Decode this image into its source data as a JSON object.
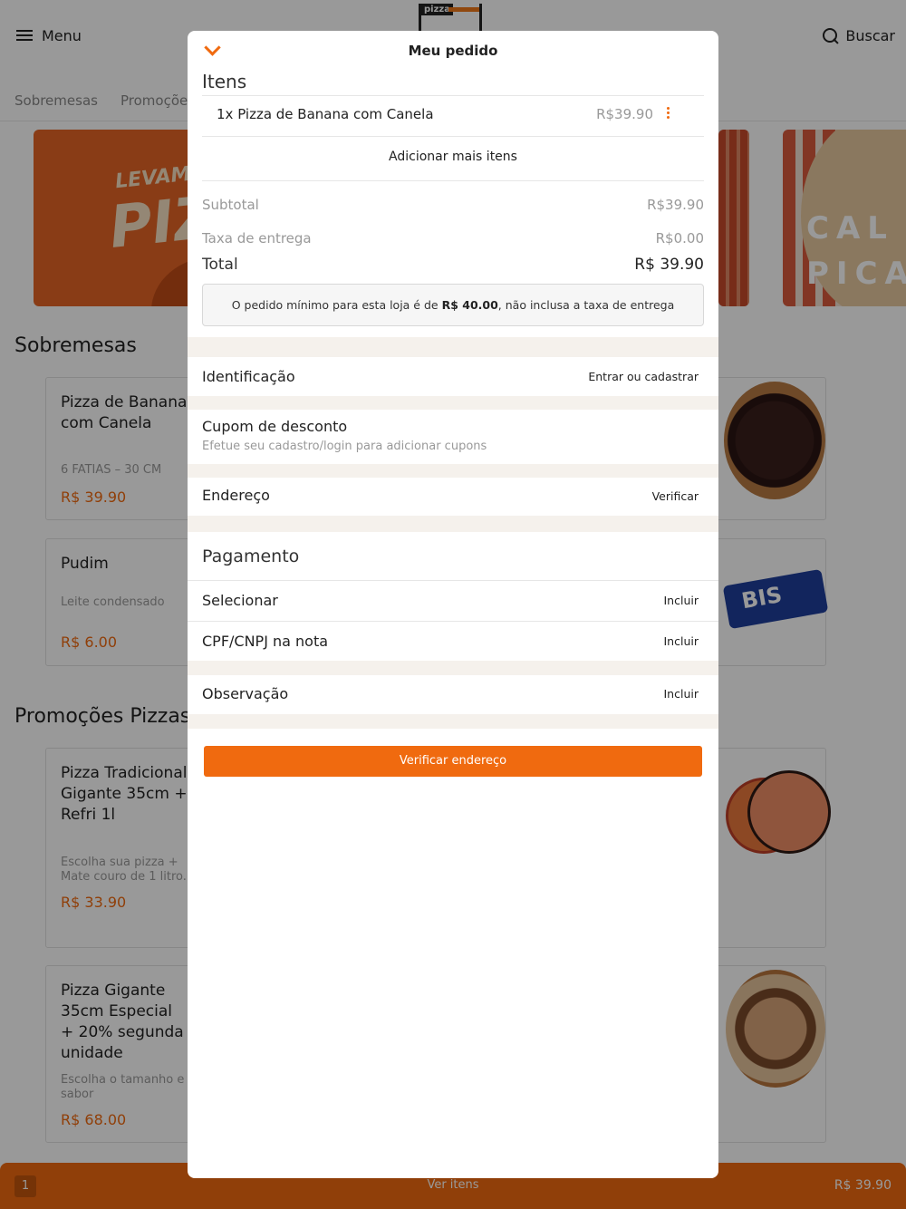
{
  "header": {
    "menu_label": "Menu",
    "search_label": "Buscar",
    "logo_text": "pizza"
  },
  "categories": [
    "Sobremesas",
    "Promoções"
  ],
  "sections": {
    "sobremesas_title": "Sobremesas",
    "promocoes_title": "Promoções Pizzas"
  },
  "products": [
    {
      "name": "Pizza de Banana com Canela",
      "desc": "6 FATIAS – 30 CM",
      "price": "R$ 39.90"
    },
    {
      "name": "Pudim",
      "desc": "Leite condensado",
      "price": "R$ 6.00"
    },
    {
      "name": "Pizza Tradicional Gigante 35cm + Refri 1l",
      "desc": "Escolha sua pizza + Mate couro de 1 litro.",
      "price": "R$ 33.90"
    },
    {
      "name": "Pizza Gigante 35cm Especial + 20% segunda unidade",
      "desc": "Escolha o tamanho e sabor",
      "price": "R$ 68.00"
    }
  ],
  "banners": {
    "b1_line1": "LEVAMO",
    "b1_line2": "PIZ",
    "b3_text": "CAL PICA"
  },
  "bottom_bar": {
    "count": "1",
    "label": "Ver itens",
    "total": "R$ 39.90"
  },
  "order": {
    "title": "Meu pedido",
    "items_heading": "Itens",
    "items": [
      {
        "label": "1x Pizza de Banana com Canela",
        "price": "R$39.90"
      }
    ],
    "add_more": "Adicionar mais itens",
    "subtotal_label": "Subtotal",
    "subtotal_value": "R$39.90",
    "delivery_label": "Taxa de entrega",
    "delivery_value": "R$0.00",
    "total_label": "Total",
    "total_value": "R$ 39.90",
    "min_note_pre": "O pedido mínimo para esta loja é de ",
    "min_note_amount": "R$ 40.00",
    "min_note_post": ", não inclusa a taxa de entrega",
    "identification_label": "Identificação",
    "identification_action": "Entrar ou cadastrar",
    "coupon_label": "Cupom de desconto",
    "coupon_sub": "Efetue seu cadastro/login para adicionar cupons",
    "address_label": "Endereço",
    "address_action": "Verificar",
    "payment_heading": "Pagamento",
    "select_label": "Selecionar",
    "select_action": "Incluir",
    "cpf_label": "CPF/CNPJ na nota",
    "cpf_action": "Incluir",
    "note_label": "Observação",
    "note_action": "Incluir",
    "cta_label": "Verificar endereço"
  },
  "colors": {
    "accent": "#f06a0f",
    "muted": "#999999",
    "separator": "#f5f1ec"
  }
}
